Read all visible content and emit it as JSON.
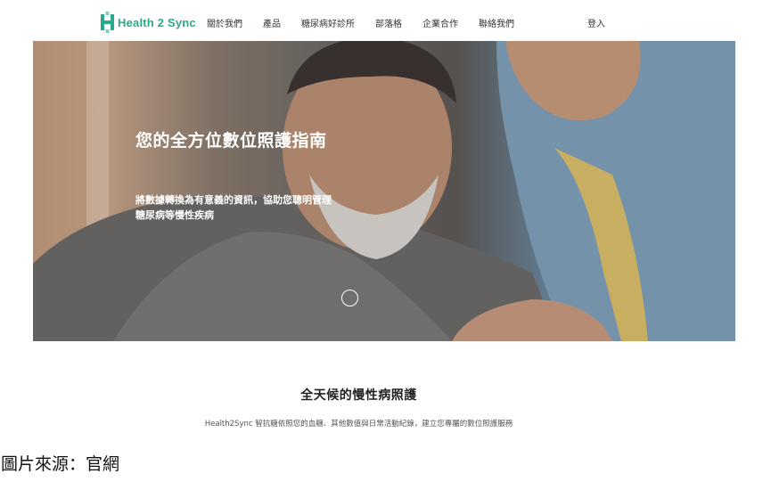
{
  "header": {
    "brand_name": "Health 2 Sync",
    "brand_color": "#2aa98b",
    "nav_items": [
      {
        "label": "關於我們"
      },
      {
        "label": "產品"
      },
      {
        "label": "糖尿病好診所"
      },
      {
        "label": "部落格"
      },
      {
        "label": "企業合作"
      },
      {
        "label": "聯絡我們"
      }
    ],
    "login_label": "登入"
  },
  "hero": {
    "title": "您的全方位數位照護指南",
    "subtitle": "將數據轉換為有意義的資訊，協助您聰明管理糖尿病等慢性疾病",
    "carousel_indicator_icon": "circle-indicator-icon"
  },
  "section": {
    "title": "全天候的慢性病照護",
    "subtitle": "Health2Sync 智抗糖依照您的血糖、其他數值與日常活動紀錄，建立您專屬的數位照護服務"
  },
  "caption": "圖片來源：官網"
}
